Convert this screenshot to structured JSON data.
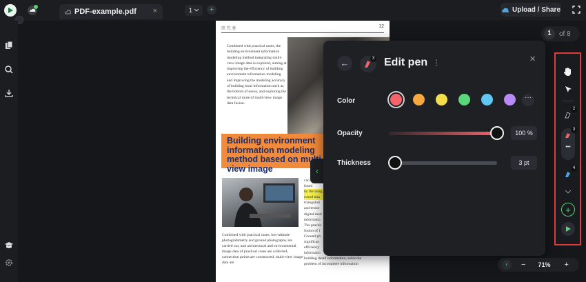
{
  "tab": {
    "title": "PDF-example.pdf",
    "close": "×"
  },
  "topbar": {
    "page_select": "1",
    "upload_label": "Upload / Share"
  },
  "document": {
    "header_left": "研 究 者",
    "page_number": "12",
    "para1": "Combined with practical cases, the building environment information modeling method integrating multi-view image data is explored, aiming at improving the efficiency of building environment information modeling and improving the modeling accuracy of building local information such as the bottom of eaves, and exploring the technical route of multi-view image data fusion.",
    "orange_title": "Building environment information modeling method based on multi-view image",
    "para2": "Combined with practical cases, low-altitude photogrammetry and ground photography are carried out, and architectural and environmental image data of practical cases are collected; connection points are constructed, multi-view image data are",
    "col2_lines": [
      "can be",
      "fused",
      "by the imag",
      "round ima",
      "triangulati",
      "and textur",
      "digital mod",
      "informatio",
      "The practic",
      "fusion of l",
      "Ground ph",
      "significan",
      "efficiency",
      "informatio",
      "building detail information, solve the",
      "problem of incomplete information"
    ]
  },
  "panel": {
    "title": "Edit pen",
    "back": "←",
    "close": "×",
    "more": "⋮",
    "pen_badge": "3",
    "color_label": "Color",
    "opacity_label": "Opacity",
    "thickness_label": "Thickness",
    "opacity_value": "100 %",
    "opacity": 1.0,
    "thickness_value": "3 pt",
    "thickness_fraction": 0.06,
    "colors": [
      "#f5646a",
      "#f7a940",
      "#f5dd4c",
      "#5bd67a",
      "#62c6f2",
      "#b98af5"
    ],
    "selected_color": "#f5646a",
    "more_colors": "···"
  },
  "page_counter": {
    "current": "1",
    "total": "of 8"
  },
  "toolbar": {
    "badge_black": "2",
    "badge_red": "3",
    "badge_blue": "4",
    "dots": "•••",
    "add": "+"
  },
  "zoom": {
    "value": "71%",
    "minus": "−",
    "plus": "+"
  },
  "colors": {
    "accent": "#5ad07a",
    "highlight_box": "#e33b3b"
  }
}
